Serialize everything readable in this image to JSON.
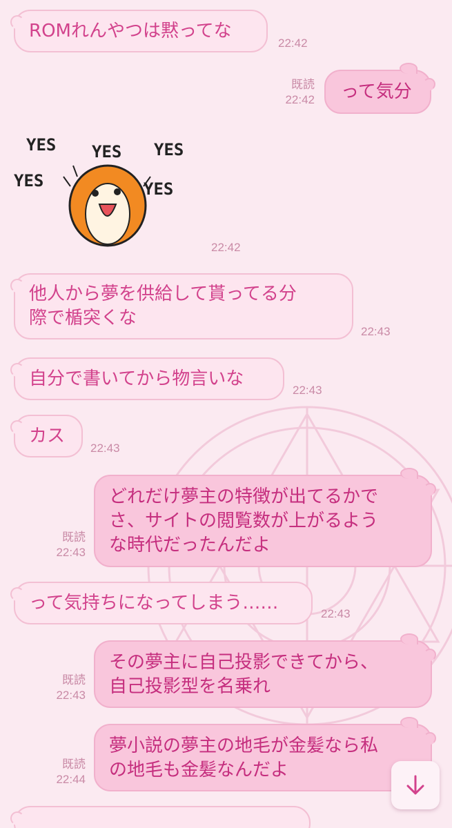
{
  "messages": [
    {
      "dir": "in",
      "lines": [
        "ROMれんやつは黙ってな"
      ],
      "time": "22:42"
    },
    {
      "dir": "out",
      "lines": [
        "って気分"
      ],
      "read": "既読",
      "time": "22:42"
    },
    {
      "dir": "in",
      "sticker": {
        "words": [
          "YES",
          "YES",
          "YES",
          "YES",
          "YES"
        ],
        "icon": "hamster-sticker-icon"
      },
      "time": "22:42"
    },
    {
      "dir": "in",
      "lines": [
        "他人から夢を供給して貰ってる分",
        "際で楯突くな"
      ],
      "time": "22:43"
    },
    {
      "dir": "in",
      "lines": [
        "自分で書いてから物言いな"
      ],
      "time": "22:43"
    },
    {
      "dir": "in",
      "lines": [
        "カス"
      ],
      "time": "22:43"
    },
    {
      "dir": "out",
      "lines": [
        "どれだけ夢主の特徴が出てるかで",
        "さ、サイトの閲覧数が上がるよう",
        "な時代だったんだよ"
      ],
      "read": "既読",
      "time": "22:43"
    },
    {
      "dir": "in",
      "lines": [
        "って気持ちになってしまう……"
      ],
      "time": "22:43"
    },
    {
      "dir": "out",
      "lines": [
        "その夢主に自己投影できてから、",
        "自己投影型を名乗れ"
      ],
      "read": "既読",
      "time": "22:43"
    },
    {
      "dir": "out",
      "lines": [
        "夢小説の夢主の地毛が金髪なら私",
        "の地毛も金髪なんだよ"
      ],
      "read": "既読",
      "time": "22:44"
    }
  ],
  "scroll_button": {
    "icon": "arrow-down-icon"
  },
  "colors": {
    "background": "#fbeaf1",
    "incoming_bubble": "#fde5ef",
    "outgoing_bubble": "#f9c6dc",
    "text": "#d2428c",
    "meta": "#c98aa6"
  }
}
